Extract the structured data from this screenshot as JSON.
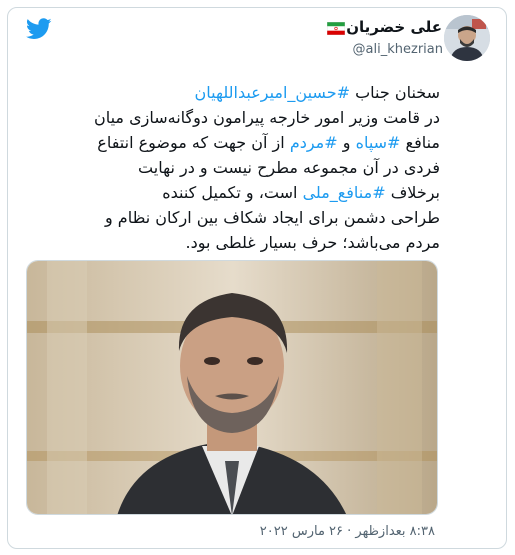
{
  "author": {
    "display_name": "علی خضریان",
    "handle": "@ali_khezrian"
  },
  "icons": {
    "brand": "twitter-bird-icon",
    "flag": "iran-flag-icon",
    "brand_color": "#1d9bf0"
  },
  "tweet": {
    "lines": [
      [
        "سخنان جناب ",
        "#حسین_امیرعبداللهیان"
      ],
      [
        "در قامت وزیر امور خارجه پیرامون دوگانه‌سازی میان"
      ],
      [
        "منافع ",
        "#سپاه",
        " و ",
        "#مردم",
        " از آن جهت که موضوع انتفاع"
      ],
      [
        "فردی در آن مجموعه مطرح نیست و در نهایت"
      ],
      [
        "برخلاف ",
        "#منافع_ملی",
        " است، و تکمیل کننده"
      ],
      [
        "طراحی دشمن برای ایجاد شکاف بین ارکان نظام و"
      ],
      [
        "مردم می‌باشد؛ حرف بسیار غلطی بود."
      ]
    ],
    "timestamp": "۸:۳۸ بعدازظهر · ۲۶ مارس ۲۰۲۲"
  }
}
